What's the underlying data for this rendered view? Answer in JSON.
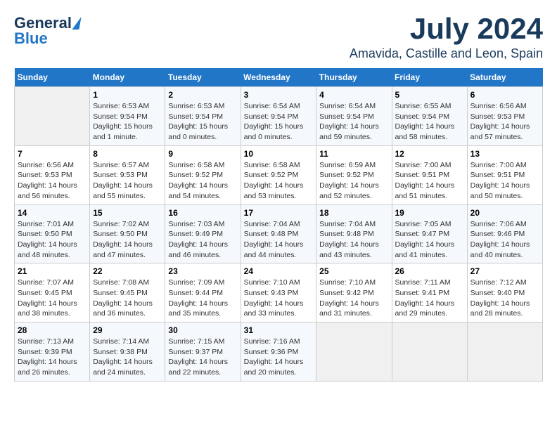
{
  "header": {
    "logo_general": "General",
    "logo_blue": "Blue",
    "month_year": "July 2024",
    "location": "Amavida, Castille and Leon, Spain"
  },
  "calendar": {
    "weekdays": [
      "Sunday",
      "Monday",
      "Tuesday",
      "Wednesday",
      "Thursday",
      "Friday",
      "Saturday"
    ],
    "weeks": [
      [
        {
          "num": "",
          "info": ""
        },
        {
          "num": "1",
          "info": "Sunrise: 6:53 AM\nSunset: 9:54 PM\nDaylight: 15 hours\nand 1 minute."
        },
        {
          "num": "2",
          "info": "Sunrise: 6:53 AM\nSunset: 9:54 PM\nDaylight: 15 hours\nand 0 minutes."
        },
        {
          "num": "3",
          "info": "Sunrise: 6:54 AM\nSunset: 9:54 PM\nDaylight: 15 hours\nand 0 minutes."
        },
        {
          "num": "4",
          "info": "Sunrise: 6:54 AM\nSunset: 9:54 PM\nDaylight: 14 hours\nand 59 minutes."
        },
        {
          "num": "5",
          "info": "Sunrise: 6:55 AM\nSunset: 9:54 PM\nDaylight: 14 hours\nand 58 minutes."
        },
        {
          "num": "6",
          "info": "Sunrise: 6:56 AM\nSunset: 9:53 PM\nDaylight: 14 hours\nand 57 minutes."
        }
      ],
      [
        {
          "num": "7",
          "info": "Sunrise: 6:56 AM\nSunset: 9:53 PM\nDaylight: 14 hours\nand 56 minutes."
        },
        {
          "num": "8",
          "info": "Sunrise: 6:57 AM\nSunset: 9:53 PM\nDaylight: 14 hours\nand 55 minutes."
        },
        {
          "num": "9",
          "info": "Sunrise: 6:58 AM\nSunset: 9:52 PM\nDaylight: 14 hours\nand 54 minutes."
        },
        {
          "num": "10",
          "info": "Sunrise: 6:58 AM\nSunset: 9:52 PM\nDaylight: 14 hours\nand 53 minutes."
        },
        {
          "num": "11",
          "info": "Sunrise: 6:59 AM\nSunset: 9:52 PM\nDaylight: 14 hours\nand 52 minutes."
        },
        {
          "num": "12",
          "info": "Sunrise: 7:00 AM\nSunset: 9:51 PM\nDaylight: 14 hours\nand 51 minutes."
        },
        {
          "num": "13",
          "info": "Sunrise: 7:00 AM\nSunset: 9:51 PM\nDaylight: 14 hours\nand 50 minutes."
        }
      ],
      [
        {
          "num": "14",
          "info": "Sunrise: 7:01 AM\nSunset: 9:50 PM\nDaylight: 14 hours\nand 48 minutes."
        },
        {
          "num": "15",
          "info": "Sunrise: 7:02 AM\nSunset: 9:50 PM\nDaylight: 14 hours\nand 47 minutes."
        },
        {
          "num": "16",
          "info": "Sunrise: 7:03 AM\nSunset: 9:49 PM\nDaylight: 14 hours\nand 46 minutes."
        },
        {
          "num": "17",
          "info": "Sunrise: 7:04 AM\nSunset: 9:48 PM\nDaylight: 14 hours\nand 44 minutes."
        },
        {
          "num": "18",
          "info": "Sunrise: 7:04 AM\nSunset: 9:48 PM\nDaylight: 14 hours\nand 43 minutes."
        },
        {
          "num": "19",
          "info": "Sunrise: 7:05 AM\nSunset: 9:47 PM\nDaylight: 14 hours\nand 41 minutes."
        },
        {
          "num": "20",
          "info": "Sunrise: 7:06 AM\nSunset: 9:46 PM\nDaylight: 14 hours\nand 40 minutes."
        }
      ],
      [
        {
          "num": "21",
          "info": "Sunrise: 7:07 AM\nSunset: 9:45 PM\nDaylight: 14 hours\nand 38 minutes."
        },
        {
          "num": "22",
          "info": "Sunrise: 7:08 AM\nSunset: 9:45 PM\nDaylight: 14 hours\nand 36 minutes."
        },
        {
          "num": "23",
          "info": "Sunrise: 7:09 AM\nSunset: 9:44 PM\nDaylight: 14 hours\nand 35 minutes."
        },
        {
          "num": "24",
          "info": "Sunrise: 7:10 AM\nSunset: 9:43 PM\nDaylight: 14 hours\nand 33 minutes."
        },
        {
          "num": "25",
          "info": "Sunrise: 7:10 AM\nSunset: 9:42 PM\nDaylight: 14 hours\nand 31 minutes."
        },
        {
          "num": "26",
          "info": "Sunrise: 7:11 AM\nSunset: 9:41 PM\nDaylight: 14 hours\nand 29 minutes."
        },
        {
          "num": "27",
          "info": "Sunrise: 7:12 AM\nSunset: 9:40 PM\nDaylight: 14 hours\nand 28 minutes."
        }
      ],
      [
        {
          "num": "28",
          "info": "Sunrise: 7:13 AM\nSunset: 9:39 PM\nDaylight: 14 hours\nand 26 minutes."
        },
        {
          "num": "29",
          "info": "Sunrise: 7:14 AM\nSunset: 9:38 PM\nDaylight: 14 hours\nand 24 minutes."
        },
        {
          "num": "30",
          "info": "Sunrise: 7:15 AM\nSunset: 9:37 PM\nDaylight: 14 hours\nand 22 minutes."
        },
        {
          "num": "31",
          "info": "Sunrise: 7:16 AM\nSunset: 9:36 PM\nDaylight: 14 hours\nand 20 minutes."
        },
        {
          "num": "",
          "info": ""
        },
        {
          "num": "",
          "info": ""
        },
        {
          "num": "",
          "info": ""
        }
      ]
    ]
  }
}
